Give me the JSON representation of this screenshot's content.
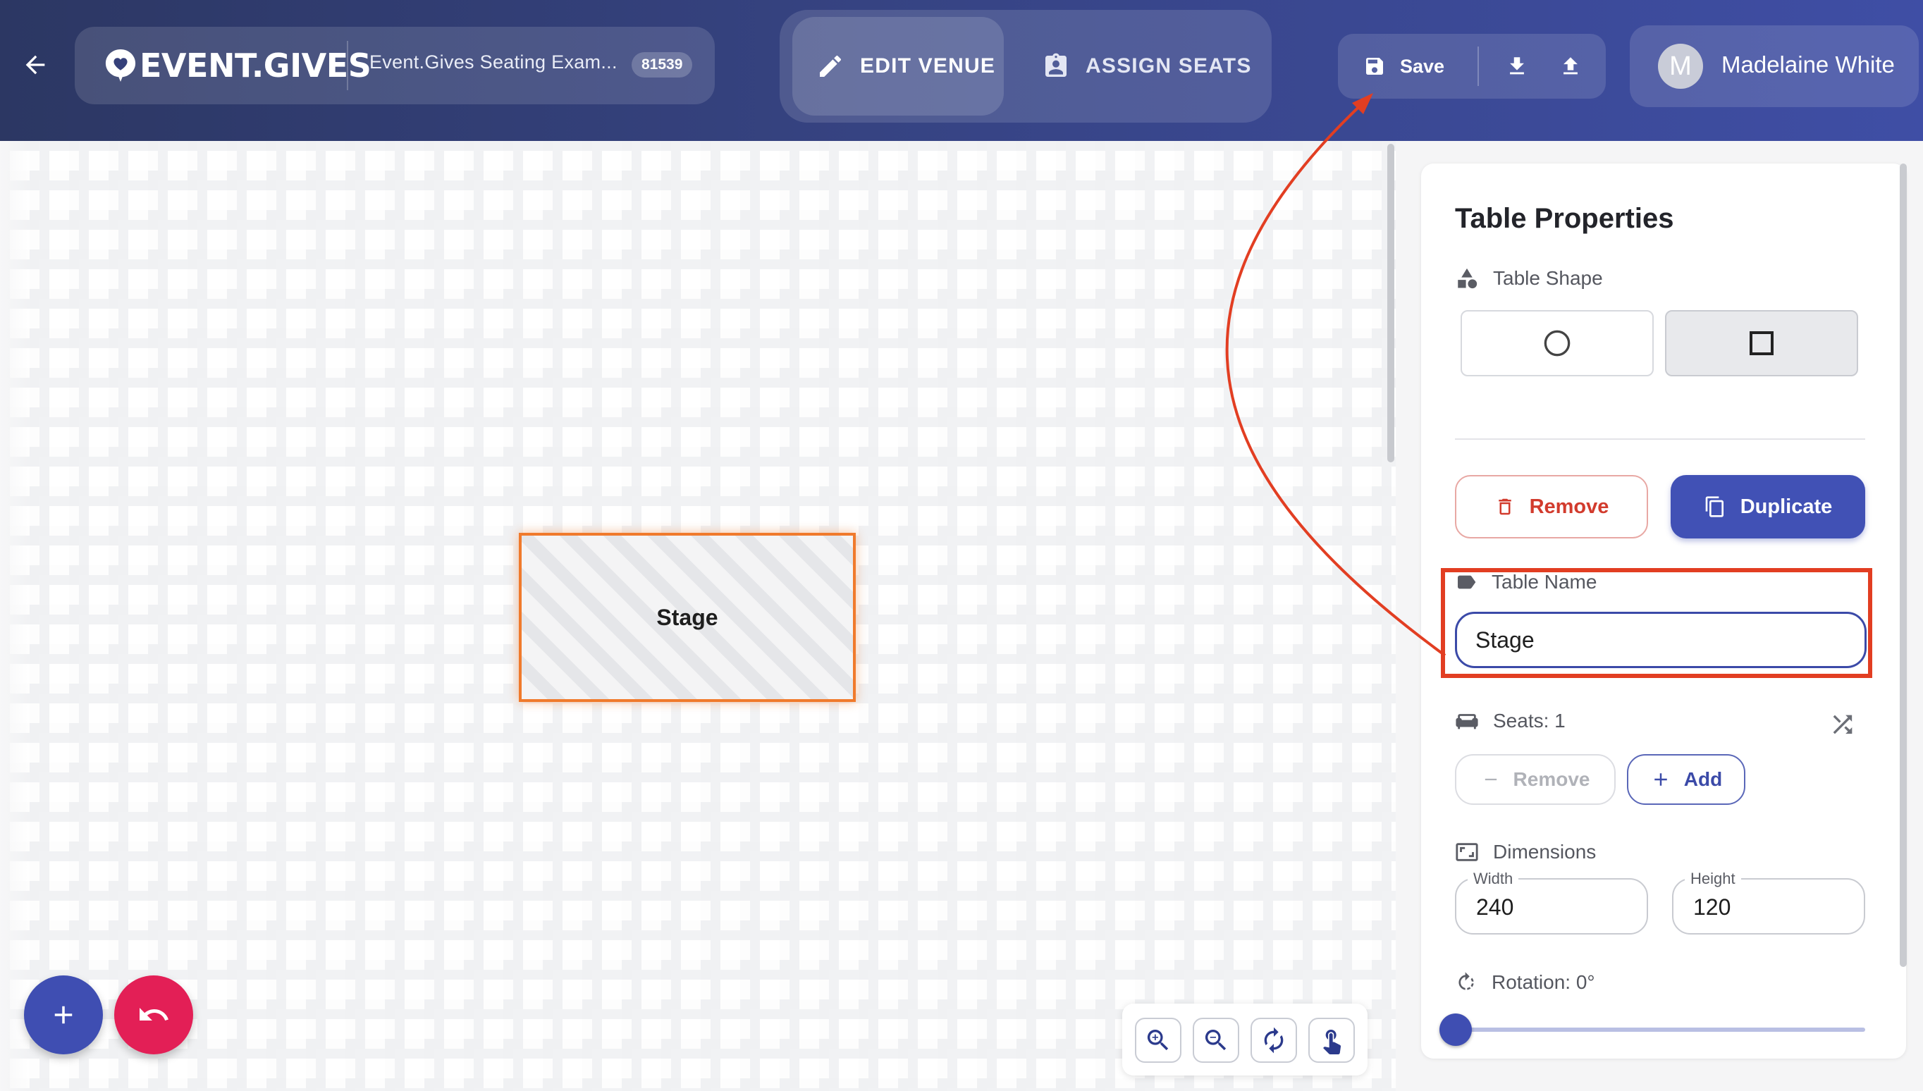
{
  "header": {
    "brand": "EVENT.GIVES",
    "event_title": "Event.Gives Seating Exam...",
    "event_id": "81539",
    "modes": [
      {
        "label": "EDIT VENUE",
        "icon": "pencil-icon",
        "active": true
      },
      {
        "label": "ASSIGN SEATS",
        "icon": "assign-seat-icon",
        "active": false
      }
    ],
    "save_label": "Save",
    "user": {
      "initial": "M",
      "name": "Madelaine White"
    }
  },
  "canvas": {
    "table": {
      "label": "Stage"
    }
  },
  "panel": {
    "title": "Table Properties",
    "shape_label": "Table Shape",
    "shapes": [
      {
        "name": "circle",
        "icon": "circle-icon",
        "active": false
      },
      {
        "name": "rectangle",
        "icon": "square-icon",
        "active": true
      }
    ],
    "remove_label": "Remove",
    "duplicate_label": "Duplicate",
    "name_label": "Table Name",
    "name_value": "Stage",
    "seats_label": "Seats: 1",
    "seat_remove_label": "Remove",
    "seat_add_label": "Add",
    "dimensions_label": "Dimensions",
    "width": {
      "label": "Width",
      "value": "240"
    },
    "height": {
      "label": "Height",
      "value": "120"
    },
    "rotation_label": "Rotation: 0°",
    "rotation_value": 0
  },
  "colors": {
    "header_accent": "#3f4ea5",
    "primary": "#4151b5",
    "danger": "#d23b2d",
    "selection": "#f07a2c",
    "annotation": "#e23e22"
  }
}
